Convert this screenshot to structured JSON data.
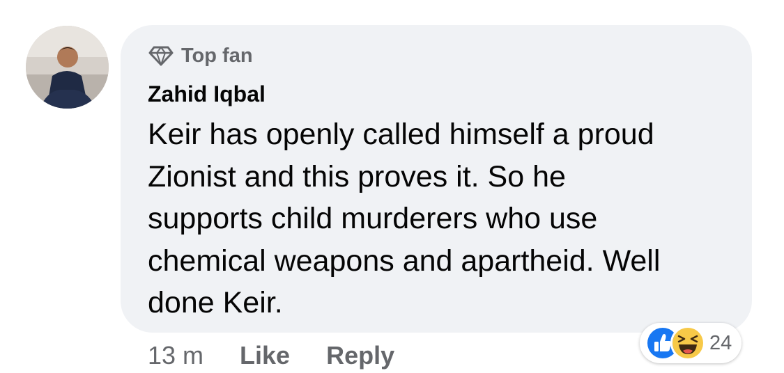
{
  "comment": {
    "badge_label": "Top fan",
    "badge_icon": "diamond-icon",
    "author": "Zahid Iqbal",
    "text": "Keir has openly called himself a proud\nZionist and this proves it. So he\nsupports child murderers who use\nchemical weapons and apartheid. Well\ndone Keir.",
    "timestamp": "13 m",
    "like_label": "Like",
    "reply_label": "Reply",
    "reactions": {
      "icons": [
        "like-icon",
        "haha-icon"
      ],
      "count": "24",
      "like_color": "#1877f2",
      "haha_color": "#f7c948"
    }
  },
  "colors": {
    "bubble_bg": "#f0f2f5",
    "secondary_text": "#65676b",
    "primary_text": "#050505"
  }
}
